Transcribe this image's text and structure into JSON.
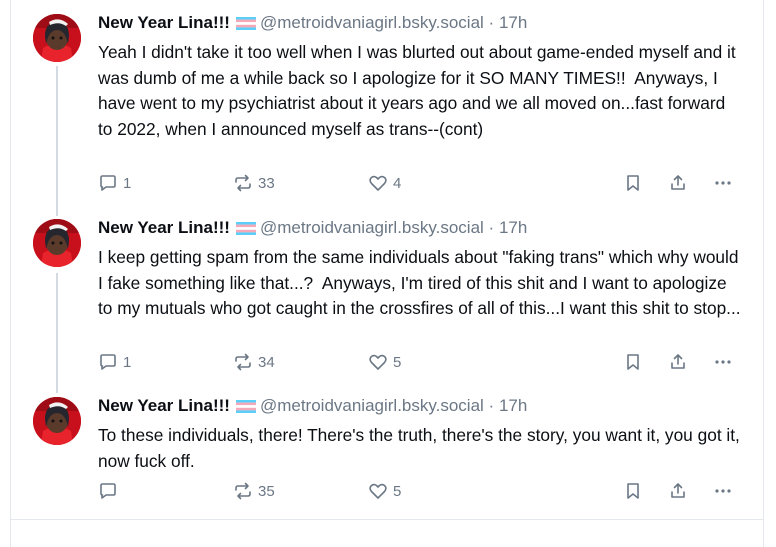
{
  "posts": [
    {
      "author_name": "New Year Lina!!!",
      "flag_icon": "trans-flag-icon",
      "handle": "@metroidvaniagirl.bsky.social",
      "separator": "·",
      "time": "17h",
      "text": "Yeah I didn't take it too well when I was blurted out about game-ended myself and it was dumb of me a while back so I apologize for it SO MANY TIMES!!  Anyways, I have went to my psychiatrist about it years ago and we all moved on...fast forward to 2022, when I announced myself as trans--(cont)",
      "reply_count": "1",
      "repost_count": "33",
      "like_count": "4"
    },
    {
      "author_name": "New Year Lina!!!",
      "flag_icon": "trans-flag-icon",
      "handle": "@metroidvaniagirl.bsky.social",
      "separator": "·",
      "time": "17h",
      "text": "I keep getting spam from the same individuals about \"faking trans\" which why would I fake something like that...?  Anyways, I'm tired of this shit and I want to apologize  to my mutuals who got caught in the crossfires of all of this...I want this shit to stop...",
      "reply_count": "1",
      "repost_count": "34",
      "like_count": "5"
    },
    {
      "author_name": "New Year Lina!!!",
      "flag_icon": "trans-flag-icon",
      "handle": "@metroidvaniagirl.bsky.social",
      "separator": "·",
      "time": "17h",
      "text": "To these individuals, there! There's the truth, there's the story, you want it, you got it, now fuck off.",
      "reply_count": "",
      "repost_count": "35",
      "like_count": "5"
    }
  ],
  "colors": {
    "muted": "#6b7785",
    "thread_line": "#d4dbe2",
    "trans_blue": "#5bcefa",
    "trans_pink": "#f5a9b8"
  }
}
